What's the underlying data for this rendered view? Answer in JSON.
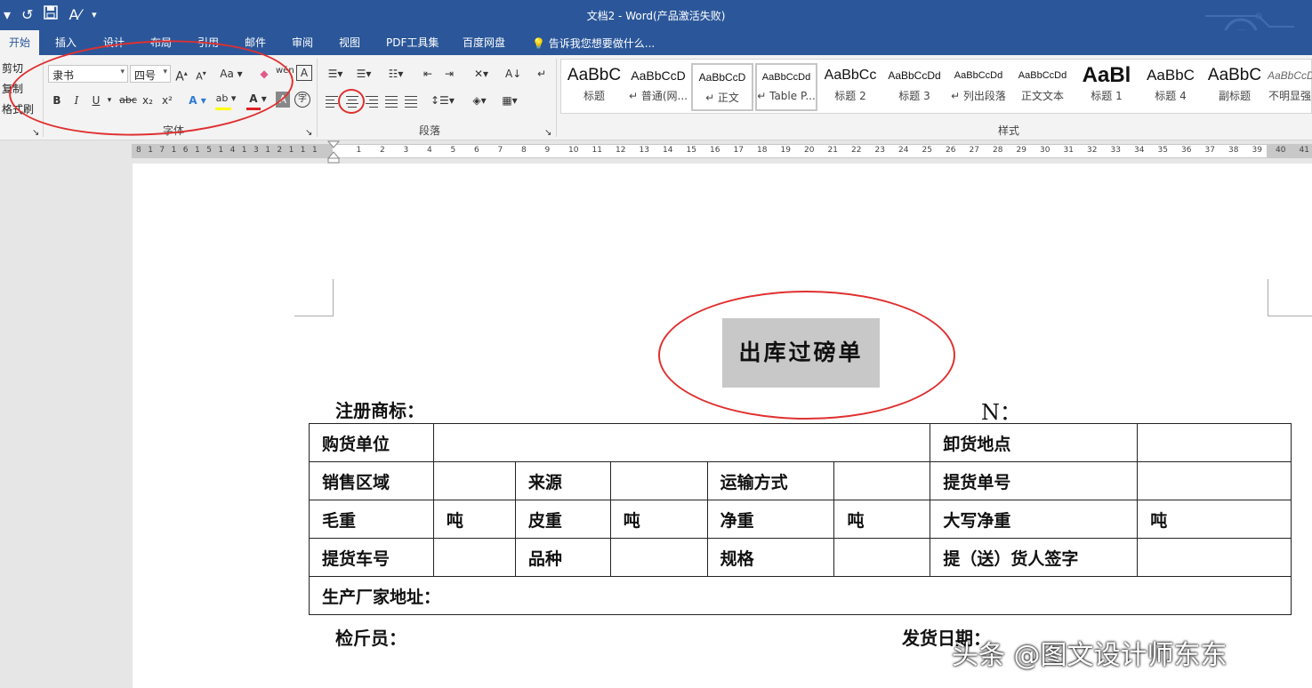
{
  "window": {
    "title": "文档2 - Word(产品激活失败)"
  },
  "quick_access": {
    "undo_icon": "undo-icon",
    "redo_icon": "redo-icon",
    "save_icon": "save-icon",
    "spell_icon": "spell-check-icon",
    "more_icon": "customize-qat-icon"
  },
  "tabs": [
    {
      "label": "开始",
      "active": true
    },
    {
      "label": "插入"
    },
    {
      "label": "设计"
    },
    {
      "label": "布局"
    },
    {
      "label": "引用"
    },
    {
      "label": "邮件"
    },
    {
      "label": "审阅"
    },
    {
      "label": "视图"
    },
    {
      "label": "PDF工具集"
    },
    {
      "label": "百度网盘"
    }
  ],
  "tell_me": "告诉我您想要做什么...",
  "clipboard": {
    "cut": "剪切",
    "copy": "复制",
    "format_painter": "格式刷"
  },
  "font": {
    "font_name": "隶书",
    "font_size": "四号",
    "bold": "B",
    "italic": "I",
    "underline": "U",
    "strikethrough": "abc",
    "subscript": "x₂",
    "superscript": "x²",
    "grow": "A",
    "shrink": "A",
    "change_case": "Aa",
    "group_label": "字体"
  },
  "paragraph": {
    "group_label": "段落"
  },
  "styles": {
    "group_label": "样式",
    "items": [
      {
        "sample": "AaBbC",
        "name": "标题"
      },
      {
        "sample": "AaBbCcD",
        "name": "↵ 普通(网..."
      },
      {
        "sample": "AaBbCcD",
        "name": "↵ 正文",
        "selected": true
      },
      {
        "sample": "AaBbCcDd",
        "name": "↵ Table P..."
      },
      {
        "sample": "AaBbCc",
        "name": "标题 2"
      },
      {
        "sample": "AaBbCcDd",
        "name": "标题 3"
      },
      {
        "sample": "AaBbCcDd",
        "name": "↵ 列出段落"
      },
      {
        "sample": "AaBbCcDd",
        "name": "正文文本"
      },
      {
        "sample": "AaBl",
        "name": "标题 1"
      },
      {
        "sample": "AaBbC",
        "name": "标题 4"
      },
      {
        "sample": "AaBbC",
        "name": "副标题"
      },
      {
        "sample": "AaBbCcDd",
        "name": "不明显强"
      }
    ]
  },
  "ruler": {
    "numbers": [
      "8",
      "1",
      "7",
      "1",
      "6",
      "1",
      "5",
      "1",
      "4",
      "1",
      "3",
      "1",
      "2",
      "1",
      "1",
      "1",
      "",
      "1",
      "2",
      "3",
      "4",
      "5",
      "6",
      "7",
      "8",
      "9",
      "10",
      "11",
      "12",
      "13",
      "14",
      "15",
      "16",
      "17",
      "18",
      "19",
      "20",
      "21",
      "22",
      "23",
      "24",
      "25",
      "26",
      "27",
      "28",
      "29",
      "30",
      "31",
      "32",
      "33",
      "34",
      "35",
      "36",
      "37",
      "38",
      "39",
      "40",
      "41"
    ]
  },
  "document": {
    "heading": "出库过磅单",
    "trademark_label": "注册商标：",
    "number_label": "N：",
    "table_rows": [
      [
        "购货单位",
        "",
        "卸货地点",
        ""
      ],
      [
        "销售区域",
        "",
        "来源",
        "",
        "运输方式",
        "",
        "提货单号",
        ""
      ],
      [
        "毛重",
        "吨",
        "皮重",
        "吨",
        "净重",
        "吨",
        "大写净重",
        "吨"
      ],
      [
        "提货车号",
        "",
        "品种",
        "",
        "规格",
        "",
        "提（送）货人签字",
        ""
      ],
      [
        "生产厂家地址："
      ]
    ],
    "inspector_label": "检斤员：",
    "date_label": "发货日期："
  },
  "watermark": "头条 @图文设计师东东",
  "colors": {
    "accent": "#2b579a",
    "annotation": "#e03030",
    "highlight": "#c8c8c8"
  }
}
